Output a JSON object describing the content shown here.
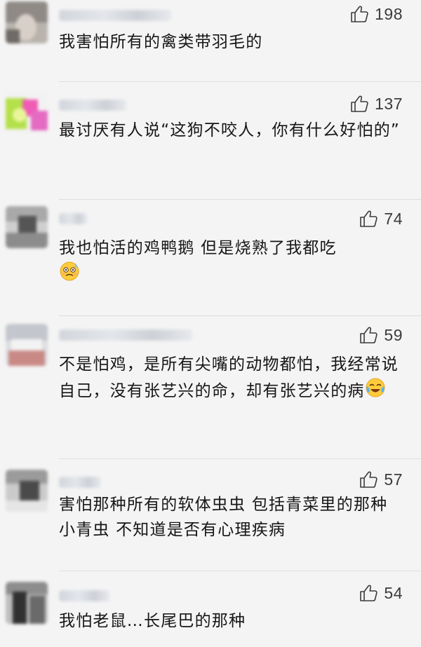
{
  "comments": [
    {
      "likes": "198",
      "text": "我害怕所有的禽类带羽毛的"
    },
    {
      "likes": "137",
      "text": "最讨厌有人说“这狗不咬人，你有什么好怕的”"
    },
    {
      "likes": "74",
      "text": "我也怕活的鸡鸭鹅 但是烧熟了我都吃",
      "emoji": "sweat-smile-emoji"
    },
    {
      "likes": "59",
      "text": "不是怕鸡，是所有尖嘴的动物都怕，我经常说自己，没有张艺兴的命，却有张艺兴的病",
      "emoji": "crying-laughing-emoji"
    },
    {
      "likes": "57",
      "text": "害怕那种所有的软体虫虫 包括青菜里的那种小青虫 不知道是否有心理疾病"
    },
    {
      "likes": "54",
      "text": "我怕老鼠…长尾巴的那种"
    }
  ],
  "icons": {
    "like": "thumbs-up-icon"
  },
  "colors": {
    "background": "#f4f4f4",
    "text": "#161616",
    "like_count": "#3b3b3b"
  }
}
